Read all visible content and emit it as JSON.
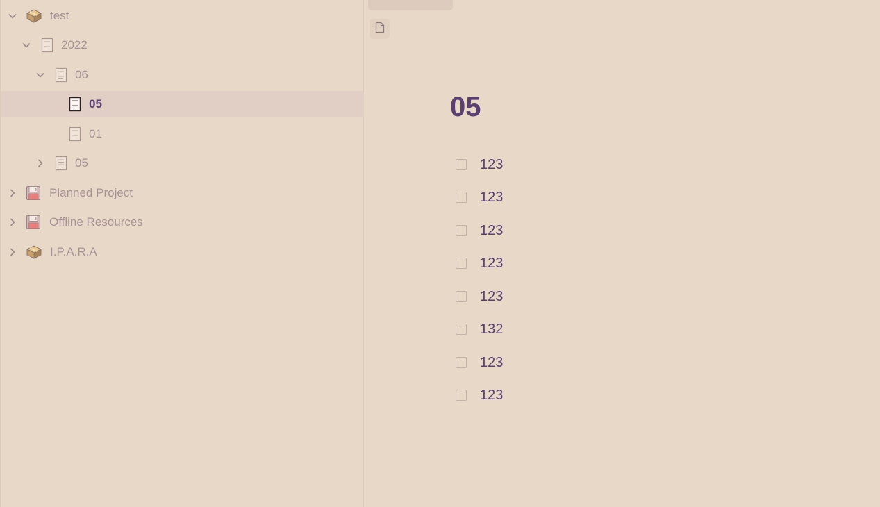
{
  "sidebar": {
    "tree": [
      {
        "label": "test",
        "icon": "box-icon",
        "expanded": true
      },
      {
        "label": "2022",
        "icon": "page-icon",
        "expanded": true
      },
      {
        "label": "06",
        "icon": "page-icon",
        "expanded": true
      },
      {
        "label": "05",
        "icon": "page-icon",
        "selected": true
      },
      {
        "label": "01",
        "icon": "page-icon"
      },
      {
        "label": "05",
        "icon": "page-icon",
        "expanded": false
      },
      {
        "label": "Planned Project",
        "icon": "floppy-disk-icon",
        "expanded": false
      },
      {
        "label": "Offline Resources",
        "icon": "floppy-disk-icon",
        "expanded": false
      },
      {
        "label": "I.P.A.R.A",
        "icon": "box-icon",
        "expanded": false
      }
    ]
  },
  "main": {
    "title": "05",
    "todos": [
      {
        "text": "123",
        "checked": false
      },
      {
        "text": "123",
        "checked": false
      },
      {
        "text": "123",
        "checked": false
      },
      {
        "text": "123",
        "checked": false
      },
      {
        "text": "123",
        "checked": false
      },
      {
        "text": "132",
        "checked": false
      },
      {
        "text": "123",
        "checked": false
      },
      {
        "text": "123",
        "checked": false
      }
    ]
  },
  "colors": {
    "background": "#e8d8c8",
    "selected_row": "#e1cfc5",
    "accent_text": "#5b3f73",
    "muted_text": "#a89296"
  }
}
